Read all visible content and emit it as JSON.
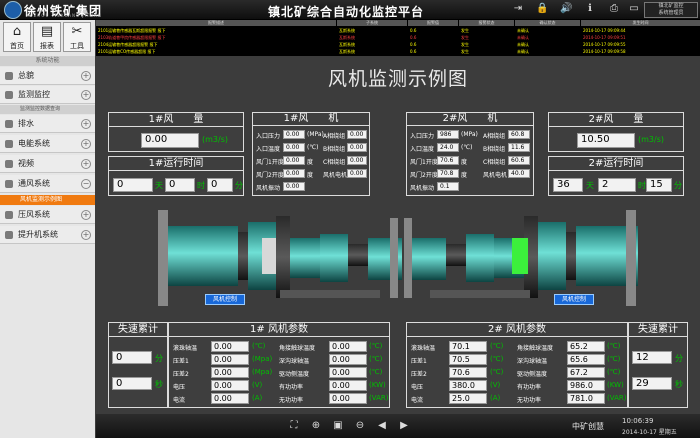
{
  "header": {
    "brand": "徐州铁矿集团",
    "brand_sub": "XUZHOU TIEKUANG JITUAN",
    "title": "镇北矿综合自动化监控平台",
    "user_line1": "镇北矿监控",
    "user_line2": "系统管理员"
  },
  "toolbar": [
    {
      "icon": "home-icon",
      "glyph": "⌂",
      "label": "首页"
    },
    {
      "icon": "report-icon",
      "glyph": "▤",
      "label": "报表"
    },
    {
      "icon": "tools-icon",
      "glyph": "✂",
      "label": "工具"
    }
  ],
  "nav": {
    "header": "系统功能",
    "items": [
      {
        "label": "总貌"
      },
      {
        "label": "监测监控"
      },
      {
        "label": "排水"
      },
      {
        "label": "电能系统"
      },
      {
        "label": "视频"
      },
      {
        "label": "通风系统"
      },
      {
        "label": "压风系统"
      },
      {
        "label": "提升机系统"
      }
    ],
    "sub_monitor": "监测监控数据查询",
    "sub_vent_selected": "风机监测示例图"
  },
  "alarm": {
    "headers": [
      "报警描述",
      "子系统",
      "报警值",
      "报警状态",
      "确认状态",
      "发生时间"
    ],
    "rows": [
      {
        "desc": "2101运输巷传感器瓦斯超限报警 报下",
        "sys": "瓦斯系统",
        "val": "0.6",
        "status": "发生",
        "ack": "未确认",
        "time": "2014-10-17 09:09:44",
        "color": "yellow"
      },
      {
        "desc": "2103轨道巷甲烷传感器超限报警 报下",
        "sys": "瓦斯系统",
        "val": "0.6",
        "status": "发生",
        "ack": "未确认",
        "time": "2014-10-17 09:09:51",
        "color": "red"
      },
      {
        "desc": "2104运输巷传感器超限报警 报下",
        "sys": "瓦斯系统",
        "val": "0.6",
        "status": "发生",
        "ack": "未确认",
        "time": "2014-10-17 09:09:55",
        "color": "yellow"
      },
      {
        "desc": "2101运输巷CO传感器超限 报下",
        "sys": "瓦斯系统",
        "val": "0.6",
        "status": "发生",
        "ack": "未确认",
        "time": "2014-10-17 09:09:58",
        "color": "yellow"
      }
    ]
  },
  "main_title": "风机监测示例图",
  "fan1": {
    "flow_title": "1#风　　量",
    "flow_value": "0.00",
    "flow_unit": "(m3/s)",
    "runtime_title": "1#运行时间",
    "days": "0",
    "hours": "0",
    "minutes": "0",
    "unit_day": "天",
    "unit_hour": "时",
    "unit_min": "分",
    "fan_title": "1#风　　机",
    "left_labels": [
      "入口压力",
      "入口温度",
      "风门1开度",
      "风门2开度",
      "风机振动"
    ],
    "left_values": [
      "0.00",
      "0.00",
      "0.00",
      "0.00",
      "0.00"
    ],
    "left_units": [
      "(MPa)",
      "(℃)",
      "度",
      "度",
      ""
    ],
    "right_labels": [
      "A相绕组",
      "B相绕组",
      "C相绕组",
      "风机电机"
    ],
    "right_values": [
      "0.00",
      "0.00",
      "0.00",
      "0.00"
    ],
    "ctrl": "风机控制",
    "acc_title": "失速累计",
    "acc_values": [
      "0",
      "0"
    ],
    "acc_units": [
      "分",
      "秒"
    ],
    "param_title": "1# 风机参数",
    "param_left_labels": [
      "滚珠轴温",
      "压差1",
      "压差2",
      "电压",
      "电流"
    ],
    "param_left_values": [
      "0.00",
      "0.00",
      "0.00",
      "0.00",
      "0.00"
    ],
    "param_left_units": [
      "(℃)",
      "(Mpa)",
      "(Mpa)",
      "(V)",
      "(A)"
    ],
    "param_right_labels": [
      "角接触球温度",
      "深沟球轴温",
      "驱动侧温度",
      "有功功率",
      "无功功率"
    ],
    "param_right_values": [
      "0.00",
      "0.00",
      "0.00",
      "0.00",
      "0.00"
    ],
    "param_right_units": [
      "(℃)",
      "(℃)",
      "(℃)",
      "(KW)",
      "(VAR)"
    ]
  },
  "fan2": {
    "flow_title": "2#风　　量",
    "flow_value": "10.50",
    "flow_unit": "(m3/s)",
    "runtime_title": "2#运行时间",
    "days": "36",
    "hours": "2",
    "minutes": "15",
    "unit_day": "天",
    "unit_hour": "时",
    "unit_min": "分",
    "fan_title": "2#风　　机",
    "left_labels": [
      "入口压力",
      "入口温度",
      "风门1开度",
      "风门2开度",
      "风机振动"
    ],
    "left_values": [
      "986",
      "24.0",
      "70.6",
      "70.8",
      "0.1"
    ],
    "left_units": [
      "(MPa)",
      "(℃)",
      "度",
      "度",
      ""
    ],
    "right_labels": [
      "A相绕组",
      "B相绕组",
      "C相绕组",
      "风机电机"
    ],
    "right_values": [
      "60.8",
      "11.6",
      "60.6",
      "40.0"
    ],
    "ctrl": "风机控制",
    "acc_title": "失速累计",
    "acc_values": [
      "12",
      "29"
    ],
    "acc_units": [
      "分",
      "秒"
    ],
    "param_title": "2# 风机参数",
    "param_left_labels": [
      "滚珠轴温",
      "压差1",
      "压差2",
      "电压",
      "电流"
    ],
    "param_left_values": [
      "70.1",
      "70.5",
      "70.6",
      "380.0",
      "25.0"
    ],
    "param_left_units": [
      "(℃)",
      "(℃)",
      "(℃)",
      "(V)",
      "(A)"
    ],
    "param_right_labels": [
      "角接触球温度",
      "深沟球轴温",
      "驱动侧温度",
      "有功功率",
      "无功功率"
    ],
    "param_right_values": [
      "65.2",
      "65.6",
      "67.2",
      "986.0",
      "781.0"
    ],
    "param_right_units": [
      "(℃)",
      "(℃)",
      "(℃)",
      "(KW)",
      "(VAR)"
    ]
  },
  "footer": {
    "company": "中矿创慧",
    "time": "10:06:39",
    "date": "2014-10-17 星期五"
  }
}
